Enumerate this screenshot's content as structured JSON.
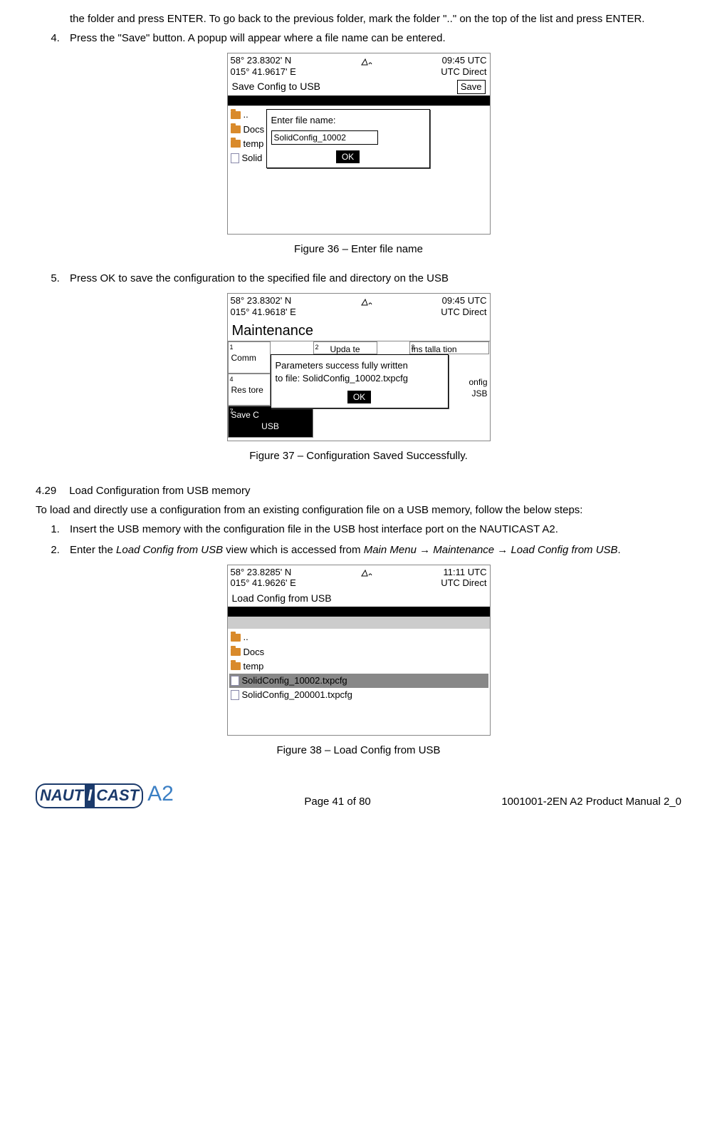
{
  "intro_text": "the folder and press ENTER. To go back to the previous folder, mark the folder \"..\" on the top of the list and press ENTER.",
  "steps_a": {
    "s4": "Press the \"Save\" button. A popup will appear where a file name can be entered.",
    "s5": "Press OK to save the configuration to the specified file and directory on the USB"
  },
  "fig36": {
    "caption": "Figure 36 – Enter file name",
    "coords_l1": "58° 23.8302' N",
    "coords_l2": "015° 41.9617' E",
    "time_l1": "09:45 UTC",
    "time_l2": "UTC Direct",
    "title": "Save Config to USB",
    "save_btn": "Save",
    "folder_up": "..",
    "folder_docs": "Docs",
    "folder_temp": "temp",
    "file_solid": "Solid",
    "popup_label": "Enter file name:",
    "popup_value": "SolidConfig_10002",
    "ok": "OK"
  },
  "fig37": {
    "caption": "Figure 37 – Configuration Saved Successfully.",
    "coords_l1": "58° 23.8302' N",
    "coords_l2": "015° 41.9618' E",
    "time_l1": "09:45 UTC",
    "time_l2": "UTC Direct",
    "title": "Maintenance",
    "m1": "Comm",
    "m2": "Upda te",
    "m3": "Ins talla tion",
    "m4": "Res tore",
    "m6a": "onfig",
    "m6b": "JSB",
    "m7a": "Save C",
    "m7b": "USB",
    "popup_l1": "Parameters success fully written",
    "popup_l2": "to file: SolidConfig_10002.txpcfg",
    "ok": "OK"
  },
  "section": {
    "num": "4.29",
    "title": "Load Configuration from USB memory"
  },
  "para_load": "To load and directly use a configuration from an existing configuration file on a USB memory, follow the below steps:",
  "steps_b": {
    "s1": "Insert the USB memory with the configuration file in the USB host interface port on the NAUTICAST A2.",
    "s2_a": "Enter the ",
    "s2_i1": "Load Config from USB",
    "s2_b": " view which is accessed from ",
    "s2_i2": "Main Menu → Maintenance → Load Config from USB",
    "s2_c": "."
  },
  "fig38": {
    "caption": "Figure 38 – Load Config from USB",
    "coords_l1": "58° 23.8285' N",
    "coords_l2": "015° 41.9626' E",
    "time_l1": "11:11 UTC",
    "time_l2": "UTC Direct",
    "title": "Load Config from USB",
    "folder_up": "..",
    "folder_docs": "Docs",
    "folder_temp": "temp",
    "file_1": "SolidConfig_10002.txpcfg",
    "file_2": "SolidConfig_200001.txpcfg"
  },
  "footer": {
    "page": "Page 41 of 80",
    "docid": "1001001-2EN A2 Product Manual 2_0",
    "logo_naut": "NAUT",
    "logo_i": "I",
    "logo_cast": "CAST",
    "logo_a2": "A2"
  }
}
